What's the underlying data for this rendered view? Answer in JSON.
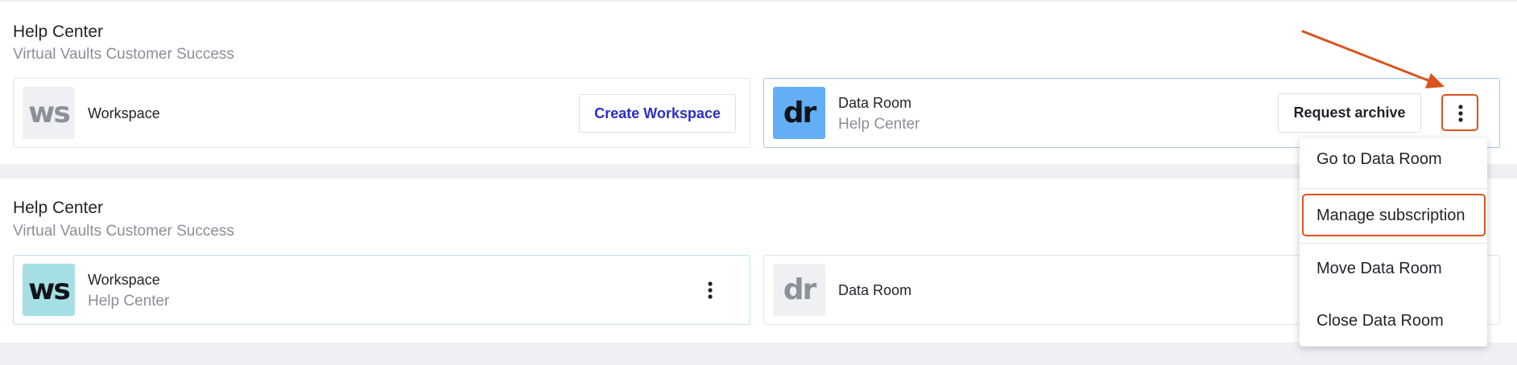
{
  "sections": [
    {
      "title": "Help Center",
      "subtitle": "Virtual Vaults Customer Success",
      "workspace": {
        "tile_text": "ws",
        "name": "Workspace",
        "button_label": "Create Workspace"
      },
      "data_room": {
        "tile_text": "dr",
        "name": "Data Room",
        "subtitle": "Help Center",
        "button_label": "Request archive"
      }
    },
    {
      "title": "Help Center",
      "subtitle": "Virtual Vaults Customer Success",
      "workspace": {
        "tile_text": "ws",
        "name": "Workspace",
        "subtitle": "Help Center"
      },
      "data_room": {
        "tile_text": "dr",
        "name": "Data Room"
      }
    }
  ],
  "dropdown_menu": {
    "items": [
      "Go to Data Room",
      "Manage subscription",
      "Move Data Room",
      "Close Data Room"
    ],
    "highlighted_item": "Manage subscription"
  },
  "icons": {
    "more_menu": "kebab-vertical-icon",
    "annotation": "arrow-icon"
  },
  "colors": {
    "link_blue": "#2b2fc6",
    "annotation_orange": "#d9531e",
    "data_room_tile": "#63aef5",
    "workspace_tile_active": "#a5dfe3"
  }
}
